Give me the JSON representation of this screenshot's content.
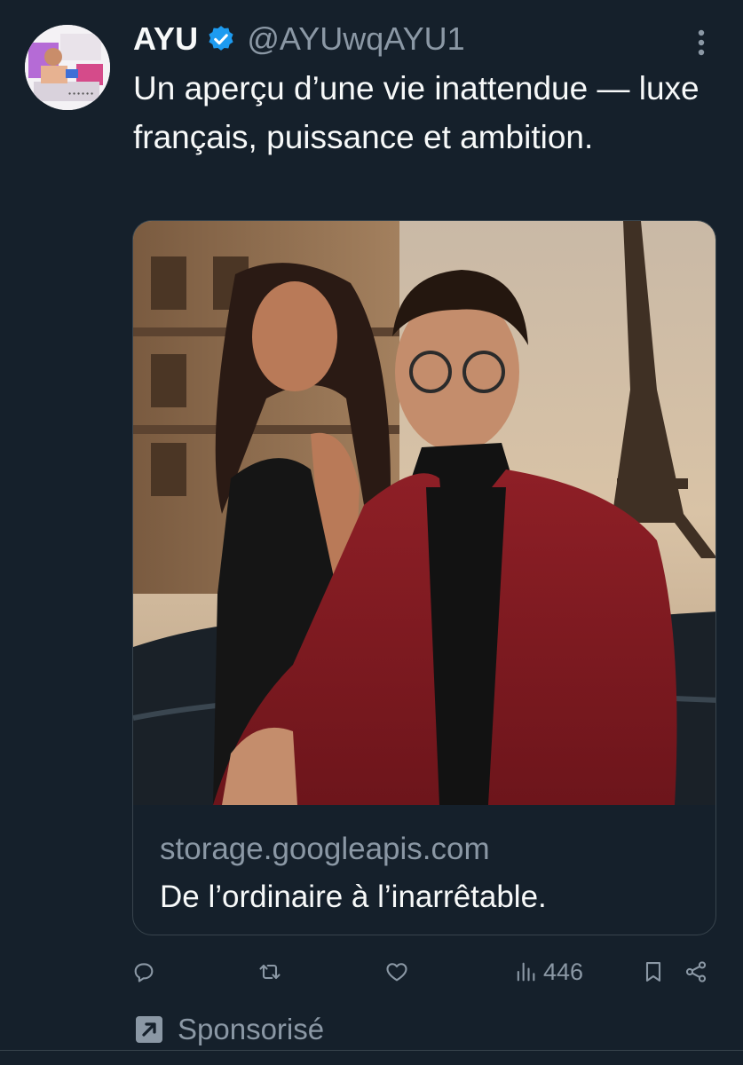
{
  "tweet": {
    "display_name": "AYU",
    "handle": "@AYUwqAYU1",
    "verified_icon": "verified-badge-icon",
    "more_icon": "more-vertical-icon",
    "text": "Un aperçu d’une vie inattendue — luxe français, puissance et ambition."
  },
  "card": {
    "domain": "storage.googleapis.com",
    "title": "De l’ordinaire à l’inarrêtable."
  },
  "actions": {
    "reply_icon": "reply-icon",
    "retweet_icon": "retweet-icon",
    "like_icon": "heart-icon",
    "views_icon": "views-chart-icon",
    "views_count": "446",
    "bookmark_icon": "bookmark-icon",
    "share_icon": "share-icon"
  },
  "promo": {
    "label": "Sponsorisé",
    "icon": "promoted-arrow-icon"
  },
  "colors": {
    "background": "#15202b",
    "text_primary": "#f7f9f9",
    "text_secondary": "#8b98a5",
    "verified_blue": "#1d9bf0",
    "border": "#38444d"
  }
}
